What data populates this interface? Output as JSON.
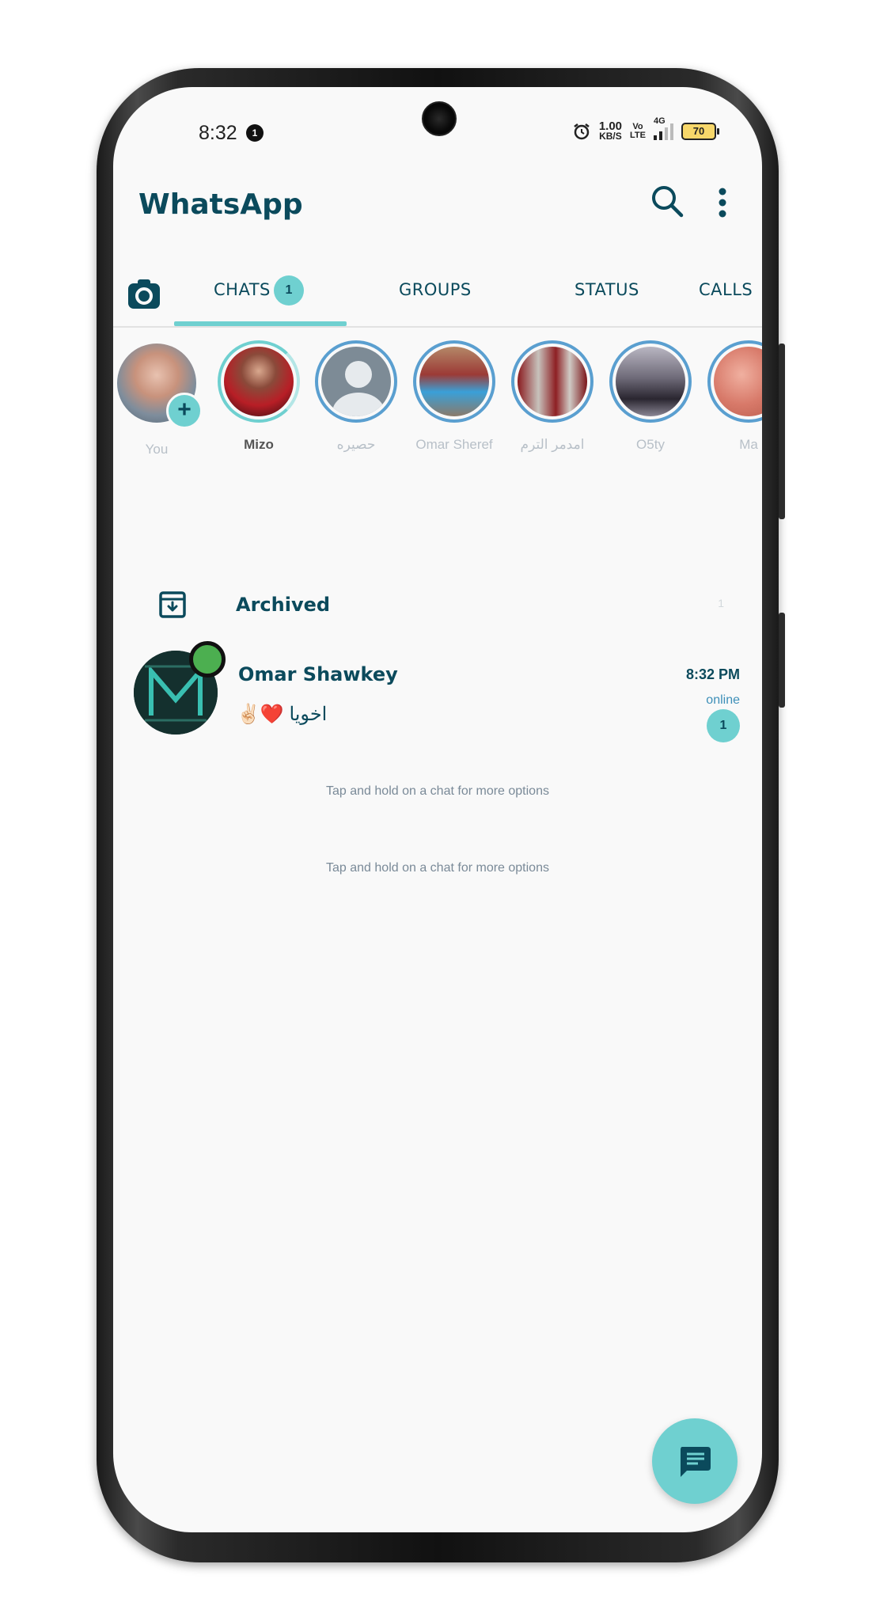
{
  "status_bar": {
    "time": "8:32",
    "notification_count": "1",
    "speed_value": "1.00",
    "speed_unit": "KB/S",
    "volte_top": "Vo",
    "volte_bottom": "LTE",
    "network_type": "4G",
    "battery": "70"
  },
  "header": {
    "title": "WhatsApp",
    "icons": [
      "search-icon",
      "more-vert-icon"
    ]
  },
  "tabs": [
    {
      "label": "CHATS",
      "badge": "1",
      "active": true
    },
    {
      "label": "GROUPS"
    },
    {
      "label": "STATUS"
    },
    {
      "label": "CALLS"
    }
  ],
  "stories": [
    {
      "name": "You"
    },
    {
      "name": "Mizo"
    },
    {
      "name": "حصيره"
    },
    {
      "name": "Omar Sheref"
    },
    {
      "name": "امدمر الترم"
    },
    {
      "name": "O5ty"
    },
    {
      "name": "Ma"
    }
  ],
  "archived": {
    "label": "Archived",
    "count": "1"
  },
  "chats": [
    {
      "name": "Omar Shawkey",
      "message": "✌🏻❤️ اخويا",
      "time": "8:32 PM",
      "status": "online",
      "unread": "1"
    }
  ],
  "hints": [
    "Tap and hold on a chat for more options",
    "Tap and hold on a chat for more options"
  ],
  "colors": {
    "accent": "#6fd0d0",
    "primary_text": "#0b4a5c",
    "story_ring": "#5a9fd0",
    "online": "#4caf50"
  }
}
